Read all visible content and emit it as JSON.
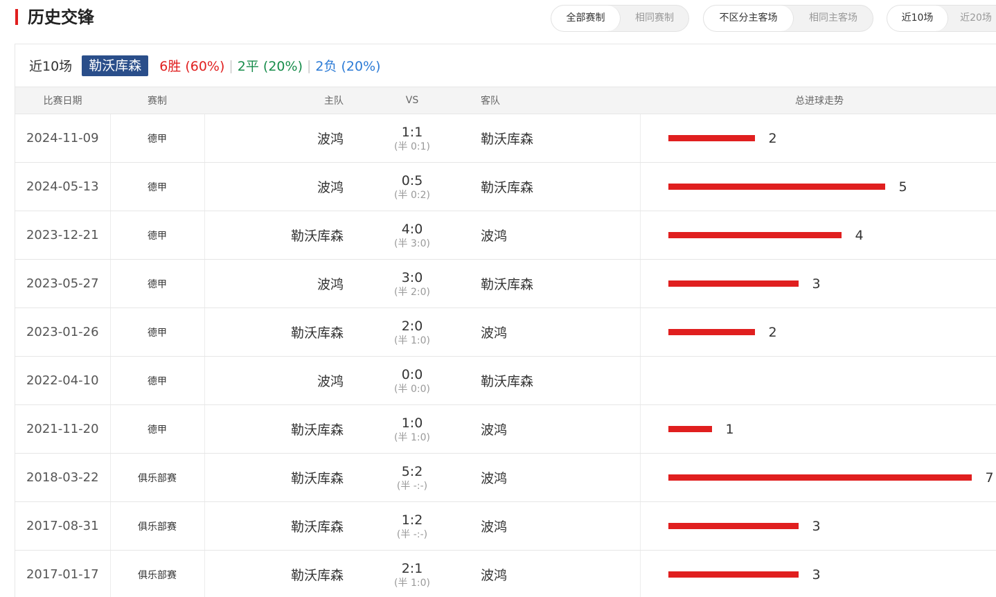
{
  "header": {
    "title": "历史交锋",
    "filters": [
      {
        "options": [
          "全部赛制",
          "相同赛制"
        ],
        "selected": 0
      },
      {
        "options": [
          "不区分主客场",
          "相同主客场"
        ],
        "selected": 0
      },
      {
        "options": [
          "近10场",
          "近20场"
        ],
        "selected": 0
      }
    ]
  },
  "summary": {
    "label": "近10场",
    "team": "勒沃库森",
    "win": "6胜 (60%)",
    "draw": "2平 (20%)",
    "loss": "2负 (20%)",
    "separator": "|"
  },
  "table": {
    "columns": [
      "比赛日期",
      "赛制",
      "主队",
      "VS",
      "客队",
      "总进球走势"
    ],
    "max_goals": 7,
    "rows": [
      {
        "date": "2024-11-09",
        "league": "德甲",
        "home": "波鸿",
        "home_color": "black",
        "score": "1:1",
        "half": "(半 0:1)",
        "away": "勒沃库森",
        "away_color": "green",
        "goals": 2,
        "goals_label": "2"
      },
      {
        "date": "2024-05-13",
        "league": "德甲",
        "home": "波鸿",
        "home_color": "black",
        "score": "0:5",
        "half": "(半 0:2)",
        "away": "勒沃库森",
        "away_color": "red",
        "goals": 5,
        "goals_label": "5"
      },
      {
        "date": "2023-12-21",
        "league": "德甲",
        "home": "勒沃库森",
        "home_color": "red",
        "score": "4:0",
        "half": "(半 3:0)",
        "away": "波鸿",
        "away_color": "black",
        "goals": 4,
        "goals_label": "4"
      },
      {
        "date": "2023-05-27",
        "league": "德甲",
        "home": "波鸿",
        "home_color": "black",
        "score": "3:0",
        "half": "(半 2:0)",
        "away": "勒沃库森",
        "away_color": "blue",
        "goals": 3,
        "goals_label": "3"
      },
      {
        "date": "2023-01-26",
        "league": "德甲",
        "home": "勒沃库森",
        "home_color": "red",
        "score": "2:0",
        "half": "(半 1:0)",
        "away": "波鸿",
        "away_color": "black",
        "goals": 2,
        "goals_label": "2"
      },
      {
        "date": "2022-04-10",
        "league": "德甲",
        "home": "波鸿",
        "home_color": "black",
        "score": "0:0",
        "half": "(半 0:0)",
        "away": "勒沃库森",
        "away_color": "green",
        "goals": 0,
        "goals_label": ""
      },
      {
        "date": "2021-11-20",
        "league": "德甲",
        "home": "勒沃库森",
        "home_color": "red",
        "score": "1:0",
        "half": "(半 1:0)",
        "away": "波鸿",
        "away_color": "black",
        "goals": 1,
        "goals_label": "1"
      },
      {
        "date": "2018-03-22",
        "league": "俱乐部赛",
        "home": "勒沃库森",
        "home_color": "red",
        "score": "5:2",
        "half": "(半 -:-)",
        "away": "波鸿",
        "away_color": "black",
        "goals": 7,
        "goals_label": "7"
      },
      {
        "date": "2017-08-31",
        "league": "俱乐部赛",
        "home": "勒沃库森",
        "home_color": "blue",
        "score": "1:2",
        "half": "(半 -:-)",
        "away": "波鸿",
        "away_color": "black",
        "goals": 3,
        "goals_label": "3"
      },
      {
        "date": "2017-01-17",
        "league": "俱乐部赛",
        "home": "勒沃库森",
        "home_color": "red",
        "score": "2:1",
        "half": "(半 1:0)",
        "away": "波鸿",
        "away_color": "black",
        "goals": 3,
        "goals_label": "3"
      }
    ]
  }
}
